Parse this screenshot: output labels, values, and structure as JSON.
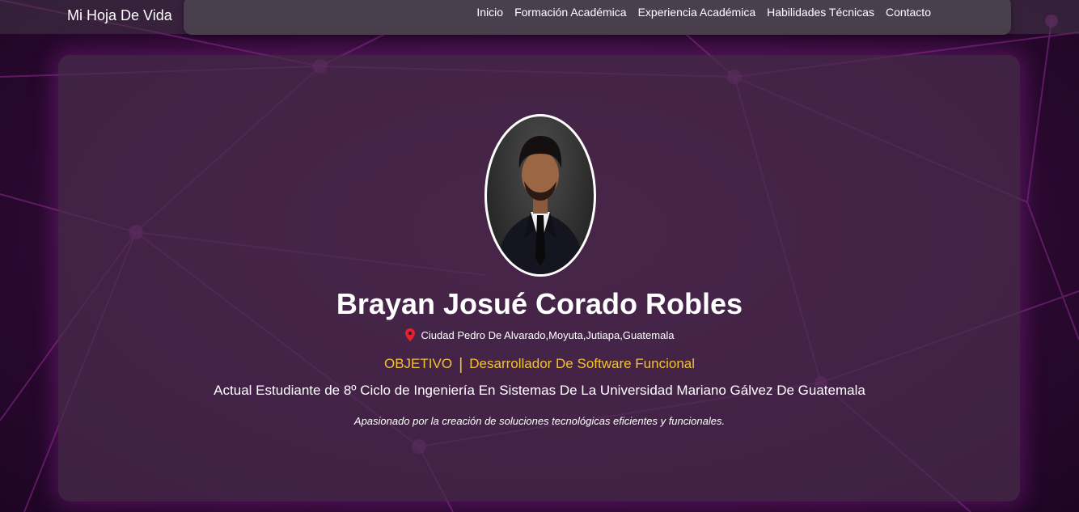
{
  "nav": {
    "brand": "Mi Hoja De Vida",
    "links": [
      "Inicio",
      "Formación Académica",
      "Experiencia Académica",
      "Habilidades Técnicas",
      "Contacto"
    ]
  },
  "profile": {
    "name": "Brayan Josué Corado Robles",
    "location": "Ciudad Pedro De Alvarado,Moyuta,Jutiapa,Guatemala",
    "location_icon": "map-pin-icon",
    "objective_label": "OBJETIVO",
    "objective_separator": "|",
    "objective_text": "Desarrollador De Software Funcional",
    "description": "Actual Estudiante de 8º Ciclo de Ingeniería En Sistemas De La Universidad Mariano Gálvez De Guatemala",
    "tagline": "Apasionado por la creación de soluciones tecnológicas eficientes y funcionales."
  },
  "colors": {
    "background": "#2d0a32",
    "network_lines": "#8a2a8e",
    "accent_objective": "#f1c232",
    "location_pin": "#e8202a",
    "text": "#ffffff"
  }
}
